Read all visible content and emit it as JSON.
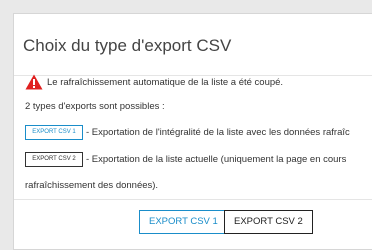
{
  "modal": {
    "title": "Choix du type d'export CSV",
    "warning_text": "Le rafraîchissement automatique de la liste a été coupé.",
    "types_text": "2 types d'exports sont possibles :",
    "options": [
      {
        "button_label": "EXPORT CSV 1",
        "description": "- Exportation de l'intégralité de la liste avec les données rafraîc"
      },
      {
        "button_label": "EXPORT CSV 2",
        "description": "- Exportation de la liste actuelle (uniquement la page en cours"
      }
    ],
    "wrap_text": "rafraîchissement des données).",
    "footer": {
      "csv1_label": "EXPORT CSV 1",
      "csv2_label": "EXPORT CSV 2"
    }
  },
  "icons": {
    "warning": "warning-triangle-icon"
  },
  "colors": {
    "accent_blue": "#1a8dc9",
    "warning_red": "#e02020",
    "dark_border": "#222222"
  }
}
